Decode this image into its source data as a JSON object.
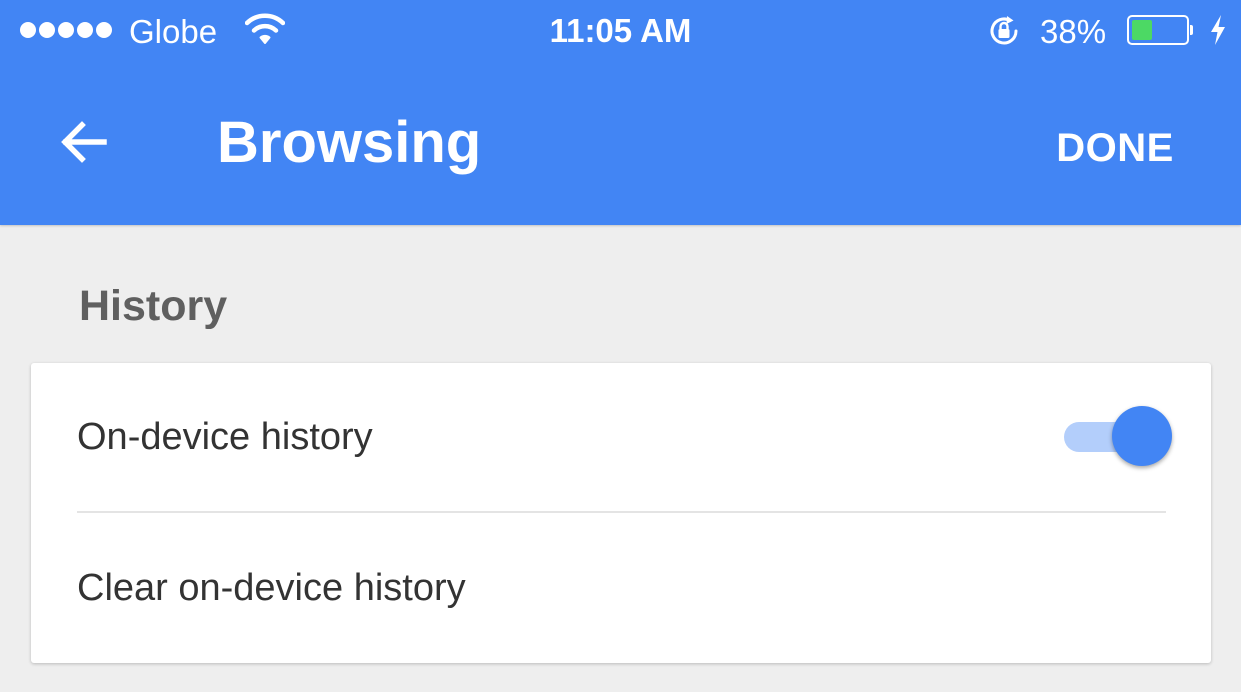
{
  "status_bar": {
    "carrier": "Globe",
    "time": "11:05 AM",
    "battery_percent": "38%",
    "battery_level": 0.38,
    "signal_bars": 5,
    "icons": [
      "signal-dots-icon",
      "wifi-icon",
      "rotation-lock-icon",
      "battery-icon",
      "charging-icon"
    ]
  },
  "app_bar": {
    "title": "Browsing",
    "back_icon": "arrow-left-icon",
    "done_label": "DONE"
  },
  "history_section": {
    "header": "History",
    "items": [
      {
        "label": "On-device history",
        "toggle_on": true
      },
      {
        "label": "Clear on-device history"
      }
    ]
  },
  "colors": {
    "primary": "#4285f4",
    "background": "#eeeeee",
    "card": "#ffffff",
    "toggle_track_on": "#b3cefb",
    "battery_fill": "#4cd964"
  }
}
